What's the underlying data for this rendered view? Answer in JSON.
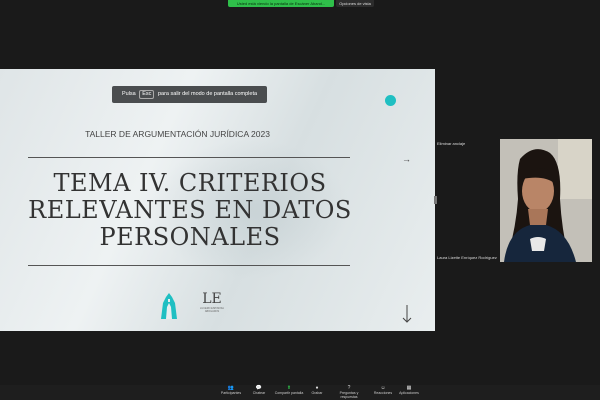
{
  "top_bar": {
    "sharing_notice": "Usted está viendo la pantalla de Escáner Aband...",
    "view_options": "Opciones de vista"
  },
  "slide": {
    "esc_banner": {
      "prefix": "Pulsa",
      "key": "Esc",
      "suffix": "para salir del modo de pantalla completa"
    },
    "subtitle": "TALLER DE ARGUMENTACIÓN JURÍDICA 2023",
    "title_line1": "TEMA IV. CRITERIOS",
    "title_line2": "RELEVANTES EN DATOS",
    "title_line3": "PERSONALES",
    "logo_monogram": "LE",
    "logo_caption_1": "LUCERO ESPINOSA",
    "logo_caption_2": "ABOGADOS",
    "accent_color": "#1fbfc2"
  },
  "participant_panel": {
    "label": "Eliminar anclaje",
    "name": "Laura Lizette Enríquez Rodríguez"
  },
  "toolbar": {
    "items": [
      {
        "label": "Participantes",
        "icon": "participants-icon"
      },
      {
        "label": "Chatear",
        "icon": "chat-icon"
      },
      {
        "label": "Compartir pantalla",
        "icon": "share-screen-icon"
      },
      {
        "label": "Grabar",
        "icon": "record-icon"
      },
      {
        "label": "Preguntas y respuestas",
        "icon": "qa-icon"
      },
      {
        "label": "Reacciones",
        "icon": "reactions-icon"
      },
      {
        "label": "Aplicaciones",
        "icon": "apps-icon"
      }
    ]
  }
}
